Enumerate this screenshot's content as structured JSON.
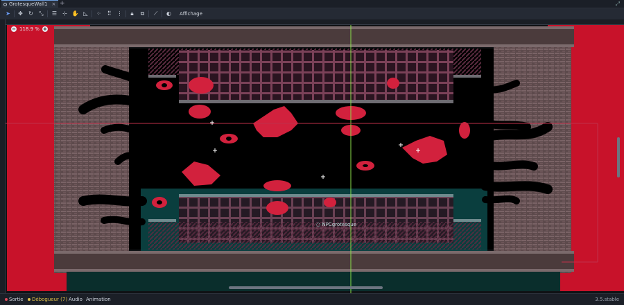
{
  "tabs": [
    {
      "label": "GrotesqueWall1",
      "close": "×"
    }
  ],
  "tab_add": "+",
  "toolbar": {
    "tools": [
      "select-icon",
      "move-icon",
      "rotate-icon",
      "scale-icon",
      "list-select-icon",
      "pan-icon",
      "ruler-icon",
      "snap-grid-icon",
      "snap-options-icon",
      "more-icon",
      "lock-icon",
      "group-icon",
      "skeleton-icon",
      "camera-icon"
    ],
    "view_menu": "Affichage"
  },
  "zoom": {
    "minus": "−",
    "value": "118.9 %",
    "plus": "+"
  },
  "scene": {
    "node_label": "NPCgrotesque",
    "colors": {
      "wall_red": "#c8122a",
      "stone": "#5b4747",
      "grate": "#7a3e55",
      "overlay": "#1c7a7a",
      "guide_green": "#8be14a",
      "guide_red": "#c0304a"
    }
  },
  "statusbar": {
    "output": "Sortie",
    "debugger": "Débogueur (7)",
    "audio": "Audio",
    "animation": "Animation",
    "version": "3.5.stable"
  }
}
